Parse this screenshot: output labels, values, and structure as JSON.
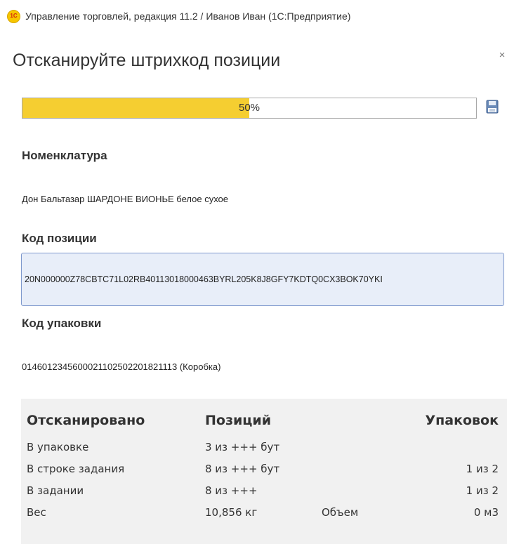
{
  "window": {
    "logo_text": "1С",
    "title": "Управление торговлей, редакция 11.2 / Иванов Иван  (1С:Предприятие)",
    "close_symbol": "×"
  },
  "form": {
    "title": "Отсканируйте штрихкод позиции"
  },
  "progress": {
    "value_percent": 50,
    "label": "50%",
    "fill_color": "#f5ce31"
  },
  "nomenclature": {
    "label": "Номенклатура",
    "value": "Дон Бальтазар ШАРДОНЕ ВИОНЬЕ белое сухое"
  },
  "position_code": {
    "label": "Код позиции",
    "value": "20N000000Z78CBTC71L02RB40113018000463BYRL205K8J8GFY7KDTQ0CX3BOK70YKI"
  },
  "package_code": {
    "label": "Код упаковки",
    "value": "0146012345600021102502201821113 (Коробка)"
  },
  "stats": {
    "header": {
      "scanned": "Отсканировано",
      "positions": "Позиций",
      "packages": "Упаковок"
    },
    "rows": [
      {
        "label": "В упаковке",
        "positions": "3 из +++ бут",
        "extra_label": "",
        "packages": ""
      },
      {
        "label": "В строке задания",
        "positions": "8 из +++ бут",
        "extra_label": "",
        "packages": "1 из 2"
      },
      {
        "label": "В задании",
        "positions": "8 из +++",
        "extra_label": "",
        "packages": "1 из 2"
      },
      {
        "label": "Вес",
        "positions": "10,856 кг",
        "extra_label": "Объем",
        "packages": "0 м3"
      }
    ]
  },
  "icons": {
    "logo": "1c-logo-icon",
    "save": "save-icon",
    "close": "close-icon"
  }
}
